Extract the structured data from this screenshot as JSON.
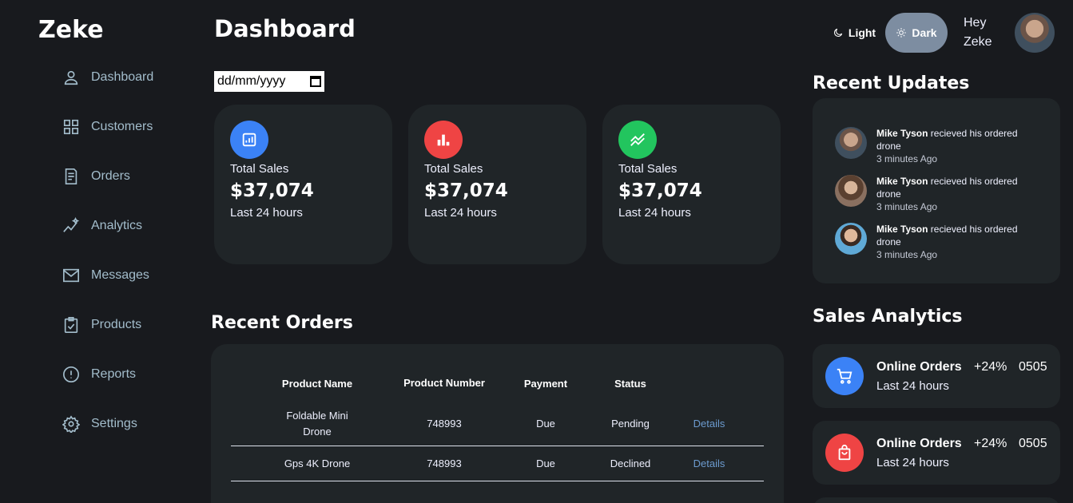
{
  "brand": "Zeke",
  "sidebar": {
    "items": [
      {
        "label": "Dashboard",
        "icon": "person-icon"
      },
      {
        "label": "Customers",
        "icon": "grid-icon"
      },
      {
        "label": "Orders",
        "icon": "receipt-icon"
      },
      {
        "label": "Analytics",
        "icon": "insights-icon"
      },
      {
        "label": "Messages",
        "icon": "mail-icon"
      },
      {
        "label": "Products",
        "icon": "clipboard-check-icon"
      },
      {
        "label": "Reports",
        "icon": "alert-circle-icon"
      },
      {
        "label": "Settings",
        "icon": "gear-icon"
      }
    ]
  },
  "header": {
    "title": "Dashboard",
    "date_placeholder": "dd/mm/yyyy",
    "theme_light": "Light",
    "theme_dark": "Dark",
    "greeting_line1": "Hey",
    "greeting_line2": "Zeke"
  },
  "cards": [
    {
      "label": "Total Sales",
      "value": "$37,074",
      "sub": "Last 24 hours",
      "color": "#3b82f6",
      "icon": "report-icon"
    },
    {
      "label": "Total Sales",
      "value": "$37,074",
      "sub": "Last 24 hours",
      "color": "#ef4444",
      "icon": "bar-chart-icon"
    },
    {
      "label": "Total Sales",
      "value": "$37,074",
      "sub": "Last 24 hours",
      "color": "#22c55e",
      "icon": "trending-icon"
    }
  ],
  "orders": {
    "title": "Recent Orders",
    "headers": [
      "Product Name",
      "Product Number",
      "Payment",
      "Status"
    ],
    "rows": [
      {
        "name": "Foldable Mini Drone",
        "number": "748993",
        "payment": "Due",
        "status": "Pending",
        "action": "Details"
      },
      {
        "name": "Gps 4K Drone",
        "number": "748993",
        "payment": "Due",
        "status": "Declined",
        "action": "Details"
      }
    ]
  },
  "updates": {
    "title": "Recent Updates",
    "items": [
      {
        "name": "Mike Tyson",
        "text": " recieved his ordered drone",
        "time": "3 minutes Ago"
      },
      {
        "name": "Mike Tyson",
        "text": " recieved his ordered drone",
        "time": "3 minutes Ago"
      },
      {
        "name": "Mike Tyson",
        "text": " recieved his ordered drone",
        "time": "3 minutes Ago"
      }
    ]
  },
  "analytics": {
    "title": "Sales Analytics",
    "items": [
      {
        "title": "Online Orders",
        "sub": "Last 24 hours",
        "pct": "+24%",
        "num": "0505",
        "color": "#3b82f6",
        "icon": "cart-icon"
      },
      {
        "title": "Online Orders",
        "sub": "Last 24 hours",
        "pct": "+24%",
        "num": "0505",
        "color": "#ef4444",
        "icon": "shopping-bag-icon"
      }
    ]
  },
  "colors": {
    "background": "#181a1e",
    "panel": "#202528",
    "accent_blue": "#3b82f6",
    "accent_red": "#ef4444",
    "accent_green": "#22c55e",
    "link": "#6c9bcf"
  }
}
